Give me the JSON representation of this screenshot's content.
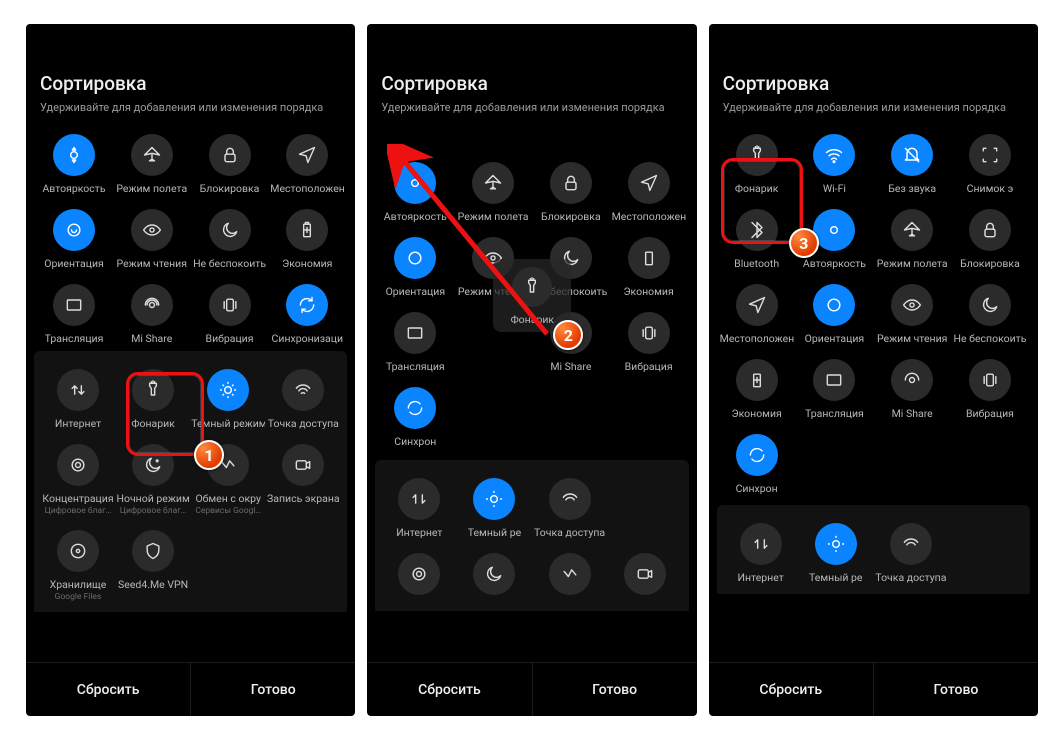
{
  "common": {
    "title": "Сортировка",
    "subtitle": "Удерживайте для добавления или изменения порядка",
    "reset": "Сбросить",
    "done": "Готово"
  },
  "markers": {
    "m1": "1",
    "m2": "2",
    "m3": "3"
  },
  "tile_labels": {
    "auto_brightness": "Автояркость",
    "airplane": "Режим полета",
    "lock": "Блокировка",
    "location": "Местоположен",
    "orientation": "Ориентация",
    "reading": "Режим чтения",
    "dnd": "Не беспокоить",
    "economy": "Экономия",
    "cast": "Трансляция",
    "mishare": "Mi Share",
    "vibration": "Вибрация",
    "sync": "Синхронизаци",
    "syncshort": "Синхрон",
    "internet": "Интернет",
    "flashlight": "Фонарик",
    "darkmode": "Темный режим",
    "darkmode_short": "Темный ре",
    "hotspot": "Точка доступа",
    "focus": "Концентрация",
    "night": "Ночной режим",
    "nearby": "Обмен с окру",
    "record": "Запись экрана",
    "storage": "Хранилище",
    "vpn": "Seed4.Me VPN",
    "wifi": "Wi-Fi",
    "silent": "Без звука",
    "screenshot": "Снимок э",
    "bluetooth": "Bluetooth"
  },
  "sub_labels": {
    "wellbeing": "Цифровое благ…",
    "gservices": "Сервисы Googl…",
    "gfiles": "Google Files"
  }
}
